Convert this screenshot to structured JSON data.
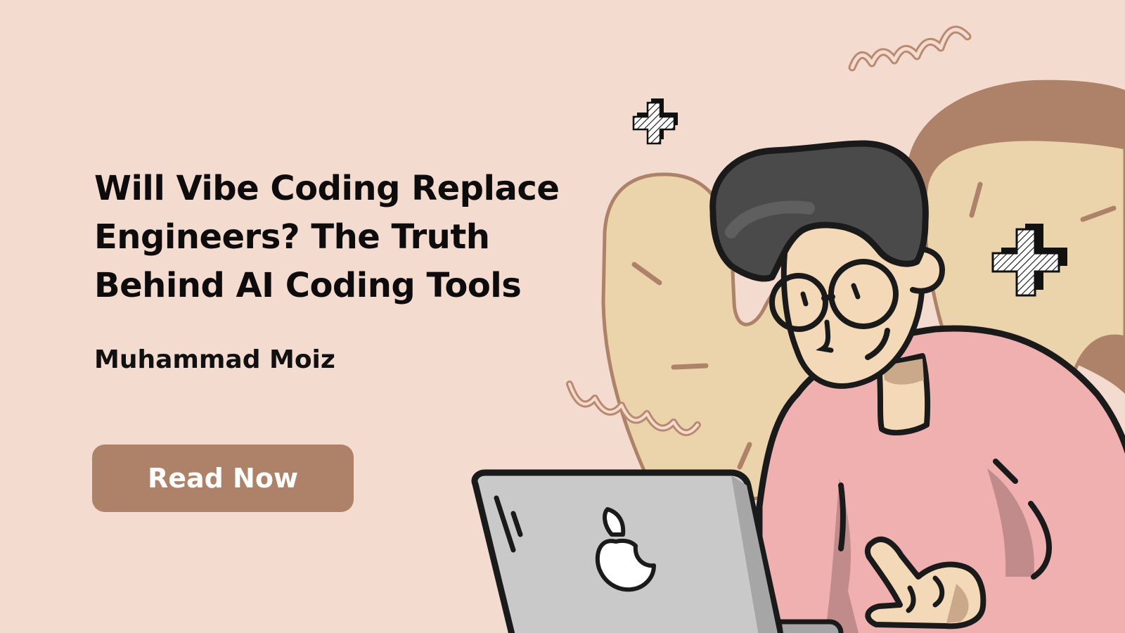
{
  "banner": {
    "title": "Will Vibe Coding Replace Engineers? The Truth Behind AI Coding Tools",
    "author": "Muhammad Moiz",
    "cta_label": "Read Now"
  },
  "colors": {
    "background": "#f3dbd0",
    "button": "#ae8268",
    "button_text": "#ffffff",
    "title_text": "#0d0b0b",
    "blob_brown": "#ae8268",
    "blob_cream": "#ebd3ab",
    "shirt_pink": "#f0b0b0",
    "hair": "#4a4a4a",
    "skin": "#f3d9b7",
    "laptop_gray": "#c9c9c9"
  },
  "icons": [
    "squiggle-decoration",
    "plus-sparkle-icon",
    "apple-logo-icon"
  ]
}
